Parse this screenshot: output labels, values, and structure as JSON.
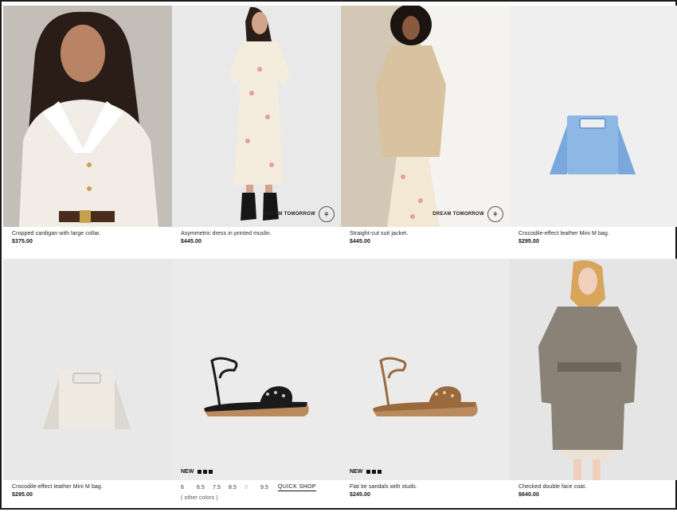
{
  "products": [
    {
      "name": "Cropped cardigan with large collar.",
      "price": "$375.00"
    },
    {
      "name": "Asymmetric dress in printed muslin.",
      "price": "$445.00",
      "badge": "DREAM TOMORROW"
    },
    {
      "name": "Straight-cut suit jacket.",
      "price": "$445.00",
      "badge": "DREAM TOMORROW"
    },
    {
      "name": "Crocodile-effect leather Mini M bag.",
      "price": "$295.00"
    },
    {
      "name": "Crocodile-effect leather Mini M bag.",
      "price": "$295.00"
    },
    {
      "new_label": "NEW",
      "sizes": [
        "6",
        "6.5",
        "7.5",
        "8.5",
        "9",
        "9.5"
      ],
      "quick_shop": "QUICK SHOP",
      "other_colors": "( other colors )"
    },
    {
      "name": "Flat tie sandals with studs.",
      "price": "$245.00",
      "new_label": "NEW"
    },
    {
      "name": "Checked double face coat.",
      "price": "$640.00"
    }
  ],
  "badge_logo_glyph": "⚘",
  "colors": {
    "bag_blue": "#8db8e6",
    "bag_cream": "#eeeae2",
    "sandal_black": "#1a1a1a",
    "sandal_tan": "#9a6a3c"
  }
}
